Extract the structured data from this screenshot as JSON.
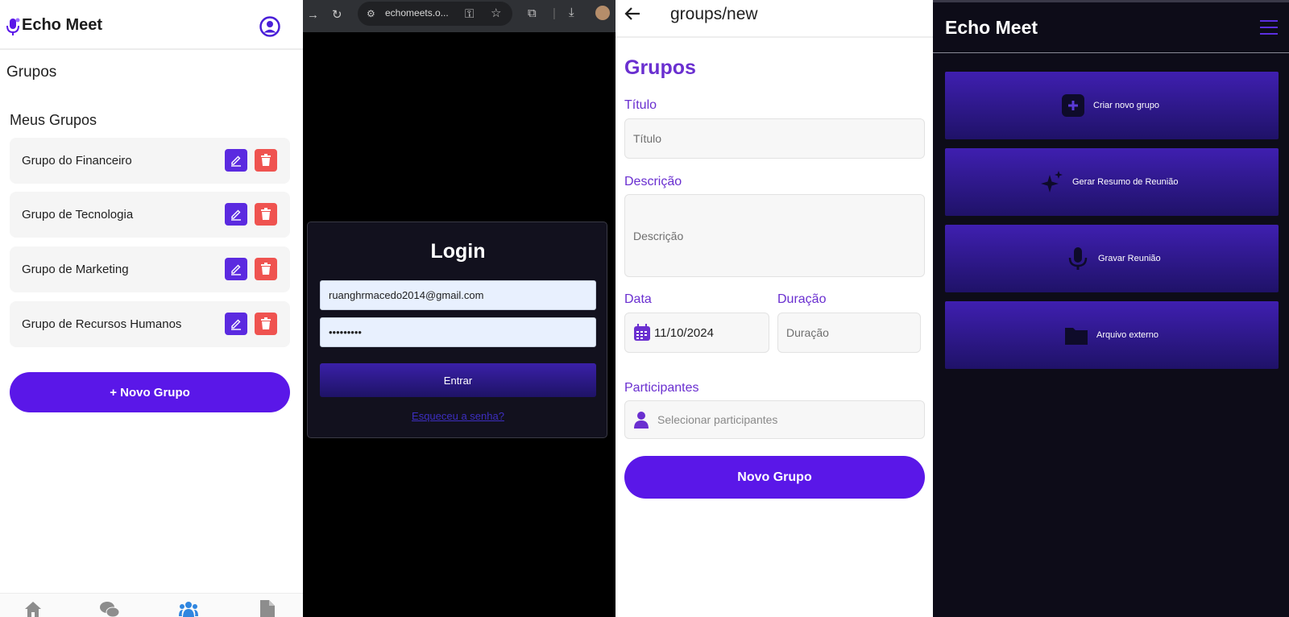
{
  "panel_list": {
    "app_title": "Echo Meet",
    "page_title": "Grupos",
    "section_title": "Meus Grupos",
    "groups": [
      {
        "name": "Grupo do Financeiro"
      },
      {
        "name": "Grupo de Tecnologia"
      },
      {
        "name": "Grupo de Marketing"
      },
      {
        "name": "Grupo de Recursos Humanos"
      }
    ],
    "new_group_label": "+ Novo Grupo",
    "nav_icons": [
      "home-icon",
      "chat-icon",
      "users-icon",
      "document-icon"
    ],
    "colors": {
      "accent": "#5a17e8",
      "delete": "#ef5350",
      "active_nav": "#2f86e0"
    }
  },
  "panel_login": {
    "url": "echomeets.o...",
    "title": "Login",
    "email_value": "ruanghrmacedo2014@gmail.com",
    "password_value": "•••••••••",
    "submit_label": "Entrar",
    "forgot_label": "Esqueceu a senha?"
  },
  "panel_form": {
    "route": "groups/new",
    "title": "Grupos",
    "title_label": "Título",
    "title_placeholder": "Título",
    "description_label": "Descrição",
    "description_placeholder": "Descrição",
    "date_label": "Data",
    "date_value": "11/10/2024",
    "duration_label": "Duração",
    "duration_placeholder": "Duração",
    "participants_label": "Participantes",
    "participants_placeholder": "Selecionar participantes",
    "submit_label": "Novo Grupo"
  },
  "panel_menu": {
    "app_title": "Echo Meet",
    "actions": [
      {
        "label": "Criar novo grupo",
        "icon": "plus-square-icon"
      },
      {
        "label": "Gerar Resumo de Reunião",
        "icon": "sparkles-icon"
      },
      {
        "label": "Gravar Reunião",
        "icon": "microphone-icon"
      },
      {
        "label": "Arquivo externo",
        "icon": "folder-icon"
      }
    ],
    "colors": {
      "background": "#0d0c18",
      "accent": "#5b2fe0"
    }
  }
}
